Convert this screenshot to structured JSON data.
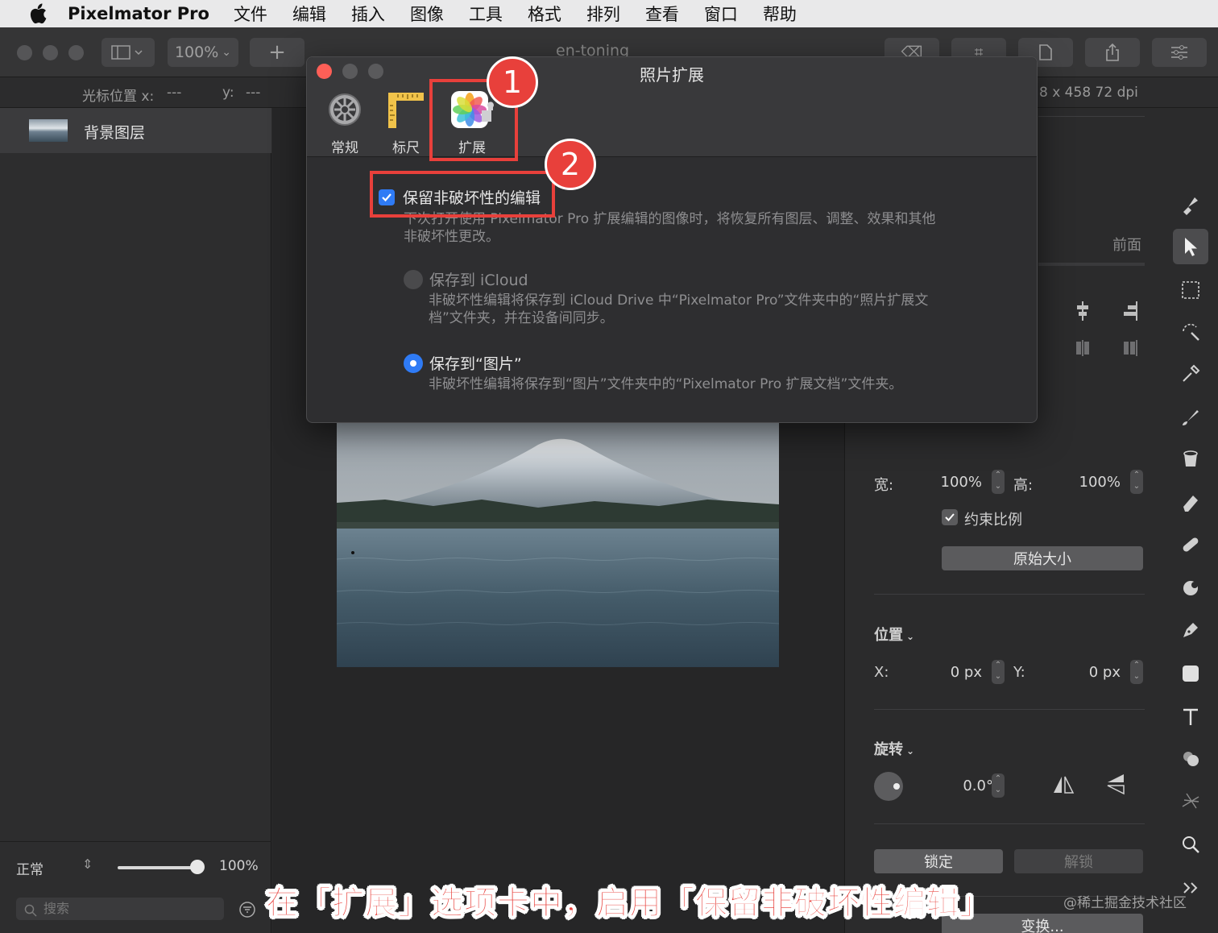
{
  "menubar": {
    "app_name": "Pixelmator Pro",
    "items": [
      "文件",
      "编辑",
      "插入",
      "图像",
      "工具",
      "格式",
      "排列",
      "查看",
      "窗口",
      "帮助"
    ]
  },
  "toolbar": {
    "zoom": "100%",
    "add": "+",
    "doc_title": "en-toning"
  },
  "infobar": {
    "cursor_x_label": "光标位置 x:",
    "cursor_x": "---",
    "cursor_y_label": "y:",
    "cursor_y": "---",
    "image_info": "8 x 458 72 dpi"
  },
  "layers": {
    "items": [
      {
        "name": "背景图层"
      }
    ],
    "blend_mode": "正常",
    "opacity": "100%",
    "search_placeholder": "搜索"
  },
  "dialog": {
    "title": "照片扩展",
    "tabs": [
      {
        "label": "常规"
      },
      {
        "label": "标尺"
      },
      {
        "label": "扩展"
      }
    ],
    "preserve_label": "保留非破坏性的编辑",
    "preserve_checked": true,
    "preserve_desc_1": "下次打开使用 Pixelmator Pro 扩展编辑的图像时，将恢复所有图层、调整、效果和其他",
    "preserve_desc_2": "非破坏性更改。",
    "icloud_label": "保存到 iCloud",
    "icloud_desc_1": "非破坏性编辑将保存到 iCloud Drive 中“Pixelmator Pro”文件夹中的“照片扩展文",
    "icloud_desc_2": "档”文件夹，并在设备间同步。",
    "photos_label": "保存到“图片”",
    "photos_desc": "非破坏性编辑将保存到“图片”文件夹中的“Pixelmator Pro 扩展文档”文件夹。",
    "selected_option": "保存到“图片”"
  },
  "inspector": {
    "front_label": "前面",
    "width_label": "宽:",
    "width_value": "100%",
    "height_label": "高:",
    "height_value": "100%",
    "constrain_label": "约束比例",
    "original_size": "原始大小",
    "position_label": "位置",
    "x_label": "X:",
    "x_value": "0 px",
    "y_label": "Y:",
    "y_value": "0 px",
    "rotate_label": "旋转",
    "rotate_value": "0.0°",
    "lock": "锁定",
    "unlock": "解锁",
    "transform": "变换..."
  },
  "annotations": {
    "badge1": "1",
    "badge2": "2",
    "caption": "在「扩展」选项卡中，启用「保留非破坏性编辑」",
    "watermark": "@稀土掘金技术社区"
  },
  "colors": {
    "accent_red": "#e8403b",
    "checkbox_blue": "#2f7bf5",
    "close_red": "#fe5f57"
  }
}
